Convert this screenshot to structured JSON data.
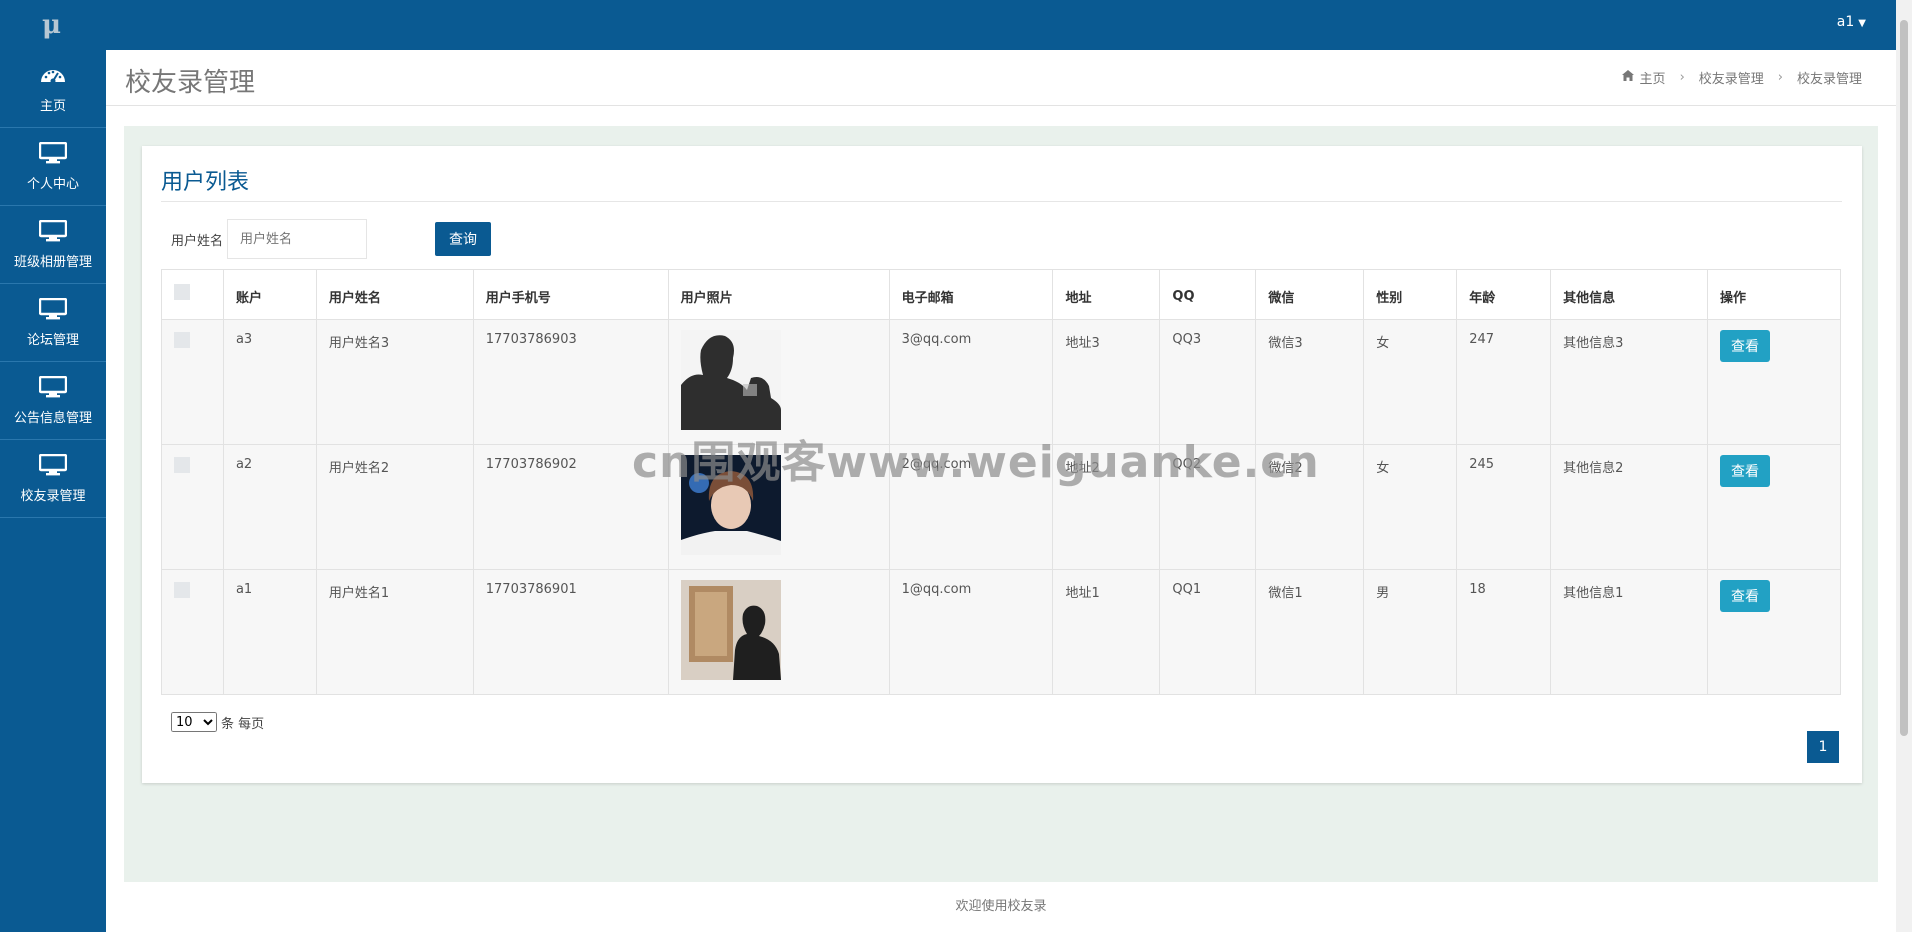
{
  "app": {
    "logo": "μ",
    "user": "a1"
  },
  "sidebar": {
    "items": [
      {
        "label": "主页",
        "icon": "dashboard-icon"
      },
      {
        "label": "个人中心",
        "icon": "monitor-icon"
      },
      {
        "label": "班级相册管理",
        "icon": "monitor-icon"
      },
      {
        "label": "论坛管理",
        "icon": "monitor-icon"
      },
      {
        "label": "公告信息管理",
        "icon": "monitor-icon"
      },
      {
        "label": "校友录管理",
        "icon": "monitor-icon"
      }
    ]
  },
  "header": {
    "title": "校友录管理",
    "breadcrumb": [
      "主页",
      "校友录管理",
      "校友录管理"
    ]
  },
  "panel": {
    "title": "用户列表",
    "search_label": "用户姓名",
    "search_placeholder": "用户姓名",
    "search_button": "查询"
  },
  "table": {
    "columns": [
      "账户",
      "用户姓名",
      "用户手机号",
      "用户照片",
      "电子邮箱",
      "地址",
      "QQ",
      "微信",
      "性别",
      "年龄",
      "其他信息",
      "操作"
    ],
    "rows": [
      {
        "account": "a3",
        "name": "用户姓名3",
        "phone": "17703786903",
        "email": "3@qq.com",
        "address": "地址3",
        "qq": "QQ3",
        "wechat": "微信3",
        "gender": "女",
        "age": "247",
        "other": "其他信息3",
        "action": "查看"
      },
      {
        "account": "a2",
        "name": "用户姓名2",
        "phone": "17703786902",
        "email": "2@qq.com",
        "address": "地址2",
        "qq": "QQ2",
        "wechat": "微信2",
        "gender": "女",
        "age": "245",
        "other": "其他信息2",
        "action": "查看"
      },
      {
        "account": "a1",
        "name": "用户姓名1",
        "phone": "17703786901",
        "email": "1@qq.com",
        "address": "地址1",
        "qq": "QQ1",
        "wechat": "微信1",
        "gender": "男",
        "age": "18",
        "other": "其他信息1",
        "action": "查看"
      }
    ]
  },
  "pagination": {
    "page_size": "10",
    "page_size_suffix": "条 每页",
    "current_page": "1"
  },
  "footer": {
    "text": "欢迎使用校友录"
  },
  "watermark": "cn围观客www.weiguanke.cn",
  "colors": {
    "primary": "#0a5a92",
    "accent": "#22a1c4",
    "content_bg": "#e9f1ec"
  }
}
